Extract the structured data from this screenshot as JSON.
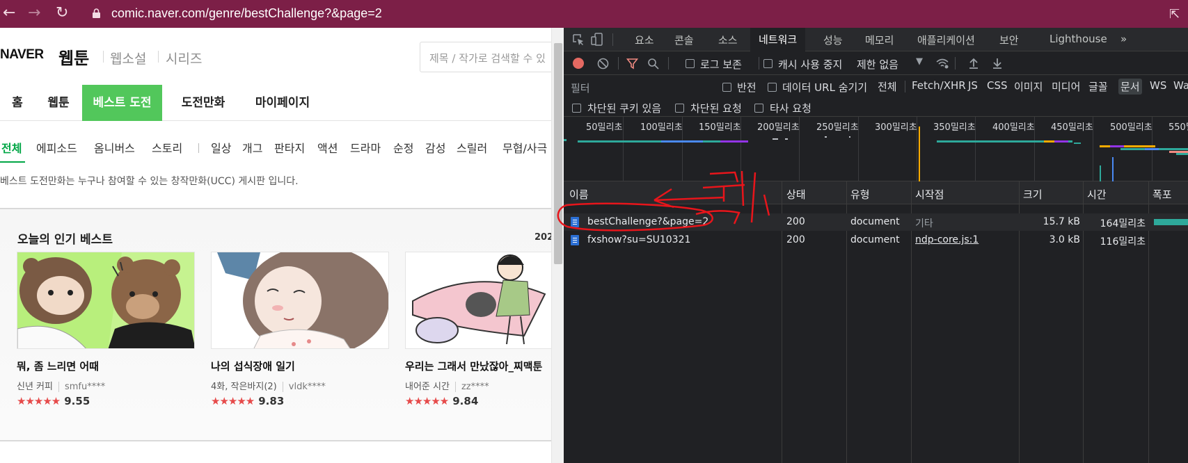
{
  "browser": {
    "back_icon": "←",
    "forward_icon": "→",
    "reload_icon": "↻",
    "url": "comic.naver.com/genre/bestChallenge?&page=2",
    "ext_icon": "⇱"
  },
  "naver": {
    "logo": "NAVER",
    "service": "웹툰",
    "service_links": [
      "웹소설",
      "시리즈"
    ],
    "search_placeholder": "제목 / 작가로 검색할 수 있",
    "gnb": [
      "홈",
      "웹툰",
      "베스트 도전",
      "도전만화",
      "마이페이지"
    ],
    "subnav": [
      "전체",
      "에피소드",
      "옴니버스",
      "스토리",
      "일상",
      "개그",
      "판타지",
      "액션",
      "드라마",
      "순정",
      "감성",
      "스릴러",
      "무협/사극"
    ],
    "notice": "베스트 도전만화는 누구나 참여할 수 있는 창작만화(UCC) 게시판 입니다.",
    "section_title": "오늘의 인기 베스트",
    "section_date": "202",
    "cards": [
      {
        "title": "뭐, 좀 느리면 어때",
        "episode": "신년 커피",
        "author": "smfu****",
        "stars": "★★★★★",
        "score": "9.55"
      },
      {
        "title": "나의 섭식장애 일기",
        "episode": "4화, 작은바지(2)",
        "author": "vldk****",
        "stars": "★★★★★",
        "score": "9.83"
      },
      {
        "title": "우리는 그래서 만났잖아_찌맥툰",
        "episode": "내어준 시간",
        "author": "zz****",
        "stars": "★★★★★",
        "score": "9.84"
      }
    ]
  },
  "devtools": {
    "tabs": [
      "요소",
      "콘솔",
      "소스",
      "네트워크",
      "성능",
      "메모리",
      "애플리케이션",
      "보안",
      "Lighthouse",
      "»"
    ],
    "active_tab": "네트워크",
    "toolbar": {
      "preserve_log": "로그 보존",
      "disable_cache": "캐시 사용 중지",
      "throttling": "제한 없음"
    },
    "filter": {
      "placeholder": "필터",
      "invert": "반전",
      "hide_data_urls": "데이터 URL 숨기기",
      "types": [
        "전체",
        "Fetch/XHR",
        "JS",
        "CSS",
        "이미지",
        "미디어",
        "글꼴",
        "문서",
        "WS",
        "Wa"
      ],
      "active_type": "문서",
      "blocked_cookies": "차단된 쿠키 있음",
      "blocked_requests": "차단된 요청",
      "third_party": "타사 요청"
    },
    "timeline_ticks": [
      "50밀리초",
      "100밀리초",
      "150밀리초",
      "200밀리초",
      "250밀리초",
      "300밀리초",
      "350밀리초",
      "400밀리초",
      "450밀리초",
      "500밀리초",
      "550밀"
    ],
    "columns": [
      "이름",
      "상태",
      "유형",
      "시작점",
      "크기",
      "시간",
      "폭포"
    ],
    "rows": [
      {
        "name": "bestChallenge?&page=2",
        "status": "200",
        "type": "document",
        "initiator": "기타",
        "size": "15.7 kB",
        "time": "164밀리초"
      },
      {
        "name": "fxshow?su=SU10321",
        "status": "200",
        "type": "document",
        "initiator": "ndp-core.js:1",
        "size": "3.0 kB",
        "time": "116밀리초"
      }
    ],
    "annotation_text": "클릭"
  },
  "colors": {
    "address_bar": "#7c1f47",
    "naver_green": "#52c75b",
    "devtools_bg": "#202124",
    "annotation": "#e8151b"
  }
}
